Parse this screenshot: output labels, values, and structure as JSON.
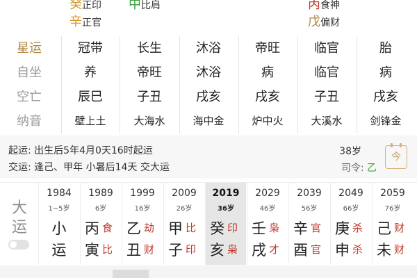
{
  "top": {
    "left": [
      {
        "char": "癸",
        "name": "正印",
        "color": "#d39a2a"
      },
      {
        "char": "辛",
        "name": "正官",
        "color": "#d39a2a"
      }
    ],
    "mid": {
      "char": "中",
      "name": "比肩",
      "color": "#3aa040"
    },
    "right": [
      {
        "char": "丙",
        "name": "食神",
        "color": "#c0392b"
      },
      {
        "char": "戊",
        "name": "偏财",
        "color": "#b08a4a"
      }
    ]
  },
  "grid": {
    "labels": [
      "星运",
      "自坐",
      "空亡",
      "纳音"
    ],
    "rows": [
      [
        "冠带",
        "长生",
        "沐浴",
        "帝旺",
        "临官",
        "胎"
      ],
      [
        "养",
        "帝旺",
        "沐浴",
        "病",
        "临官",
        "病"
      ],
      [
        "辰巳",
        "子丑",
        "戌亥",
        "戌亥",
        "子丑",
        "戌亥"
      ],
      [
        "壁上土",
        "大海水",
        "海中金",
        "炉中火",
        "大溪水",
        "剑锋金"
      ]
    ]
  },
  "info": {
    "qiyun": "起运:  出生后5年4月0天16时起运",
    "jiaoyun": "交运:  逢己、甲年 小暑后14天 交大运",
    "age": "38岁",
    "siling_label": "司令:",
    "siling_value": "乙",
    "cal_button": "今"
  },
  "dayun": {
    "label1": "大",
    "label2": "运",
    "columns": [
      {
        "year": "1984",
        "age": "1~5岁",
        "gan": "",
        "gan_ss": "",
        "zhi": "",
        "zhi_ss": "",
        "special": [
          "小",
          "运"
        ]
      },
      {
        "year": "1989",
        "age": "6岁",
        "gan": "丙",
        "gan_ss": "食",
        "zhi": "寅",
        "zhi_ss": "比"
      },
      {
        "year": "1999",
        "age": "16岁",
        "gan": "乙",
        "gan_ss": "劫",
        "zhi": "丑",
        "zhi_ss": "财"
      },
      {
        "year": "2009",
        "age": "26岁",
        "gan": "甲",
        "gan_ss": "比",
        "zhi": "子",
        "zhi_ss": "印"
      },
      {
        "year": "2019",
        "age": "36岁",
        "gan": "癸",
        "gan_ss": "印",
        "zhi": "亥",
        "zhi_ss": "枭",
        "active": true
      },
      {
        "year": "2029",
        "age": "46岁",
        "gan": "壬",
        "gan_ss": "枭",
        "zhi": "戌",
        "zhi_ss": "才"
      },
      {
        "year": "2039",
        "age": "56岁",
        "gan": "辛",
        "gan_ss": "官",
        "zhi": "酉",
        "zhi_ss": "官"
      },
      {
        "year": "2049",
        "age": "66岁",
        "gan": "庚",
        "gan_ss": "杀",
        "zhi": "申",
        "zhi_ss": "杀"
      },
      {
        "year": "2059",
        "age": "76岁",
        "gan": "己",
        "gan_ss": "财",
        "zhi": "未",
        "zhi_ss": "财"
      }
    ]
  }
}
